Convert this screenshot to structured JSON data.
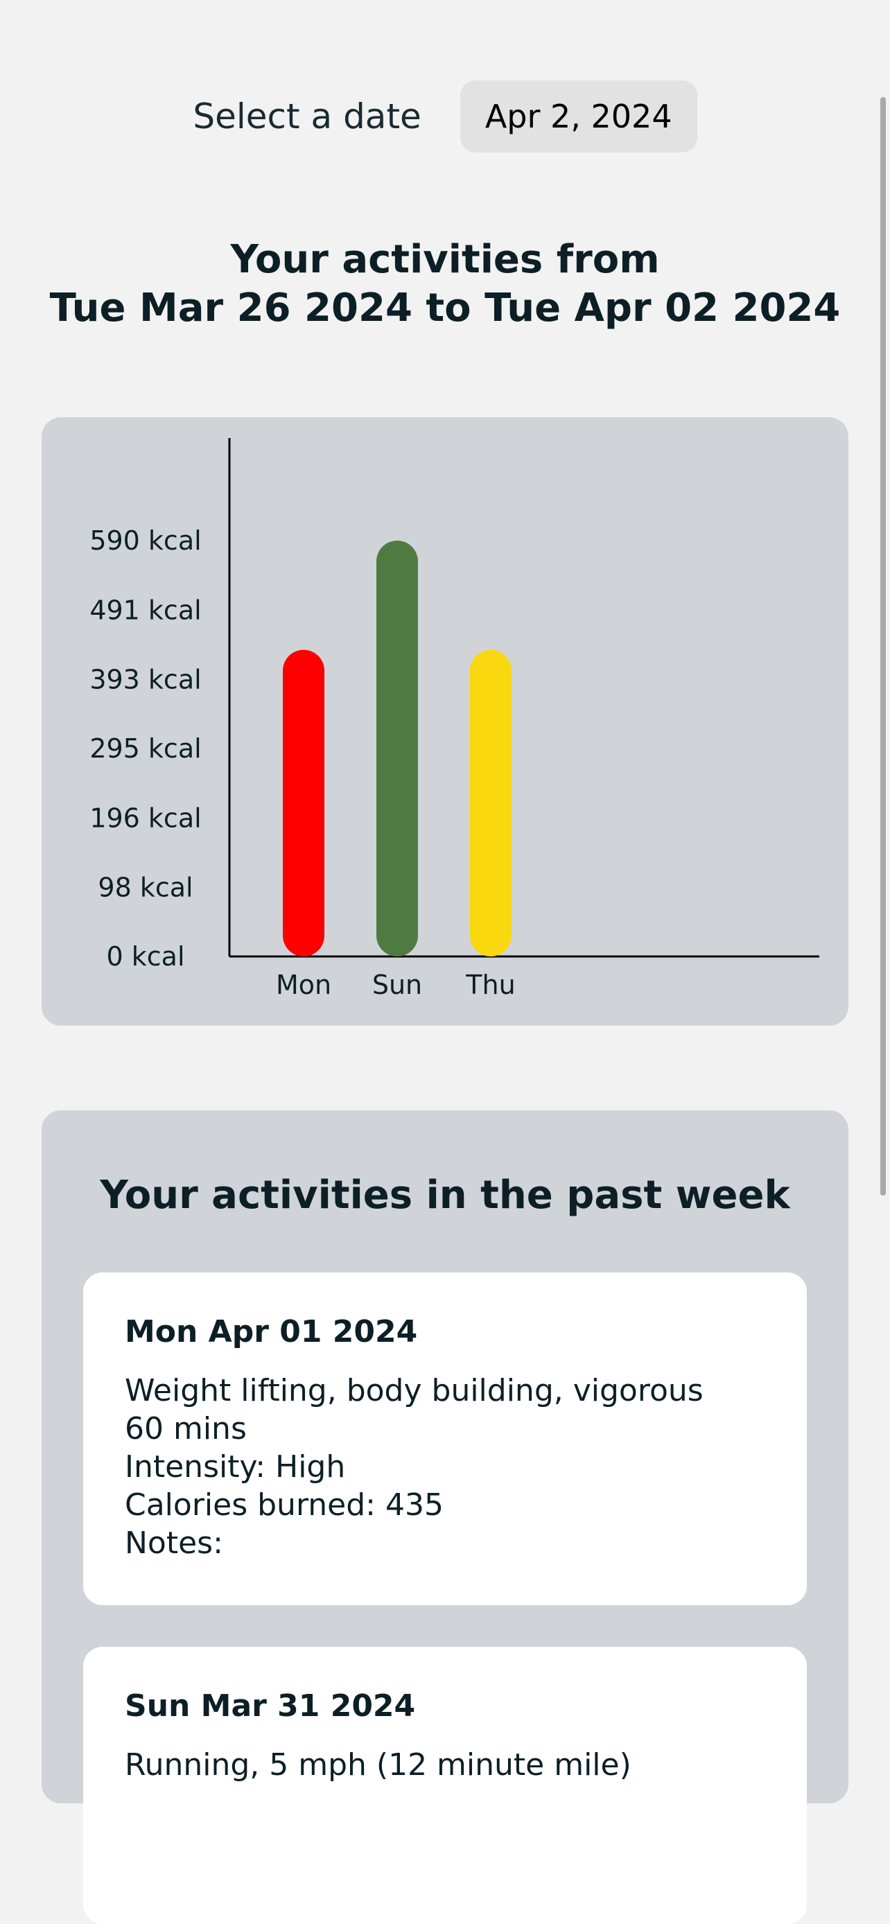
{
  "date_picker": {
    "label": "Select a date",
    "value": "Apr 2, 2024"
  },
  "title": {
    "line1": "Your activities from",
    "line2": "Tue Mar 26 2024 to Tue Apr 02 2024"
  },
  "chart_data": {
    "type": "bar",
    "categories": [
      "Mon",
      "Sun",
      "Thu"
    ],
    "values": [
      435,
      590,
      435
    ],
    "colors": [
      "#ff0000",
      "#4f7b42",
      "#fad80f"
    ],
    "ytick_labels": [
      "0 kcal",
      "98 kcal",
      "196 kcal",
      "295 kcal",
      "393 kcal",
      "491 kcal",
      "590 kcal"
    ],
    "ytick_values": [
      0,
      98,
      196,
      295,
      393,
      491,
      590
    ],
    "ylim": [
      0,
      590
    ],
    "xlabel": "",
    "ylabel": "",
    "title": ""
  },
  "week": {
    "title": "Your activities in the past week",
    "activities": [
      {
        "date": "Mon Apr 01 2024",
        "name": "Weight lifting, body building, vigorous",
        "duration": "60 mins",
        "intensity": "Intensity: High",
        "calories": "Calories burned: 435",
        "notes": "Notes:"
      },
      {
        "date": "Sun Mar 31 2024",
        "name": "Running, 5 mph (12 minute mile)"
      }
    ]
  }
}
